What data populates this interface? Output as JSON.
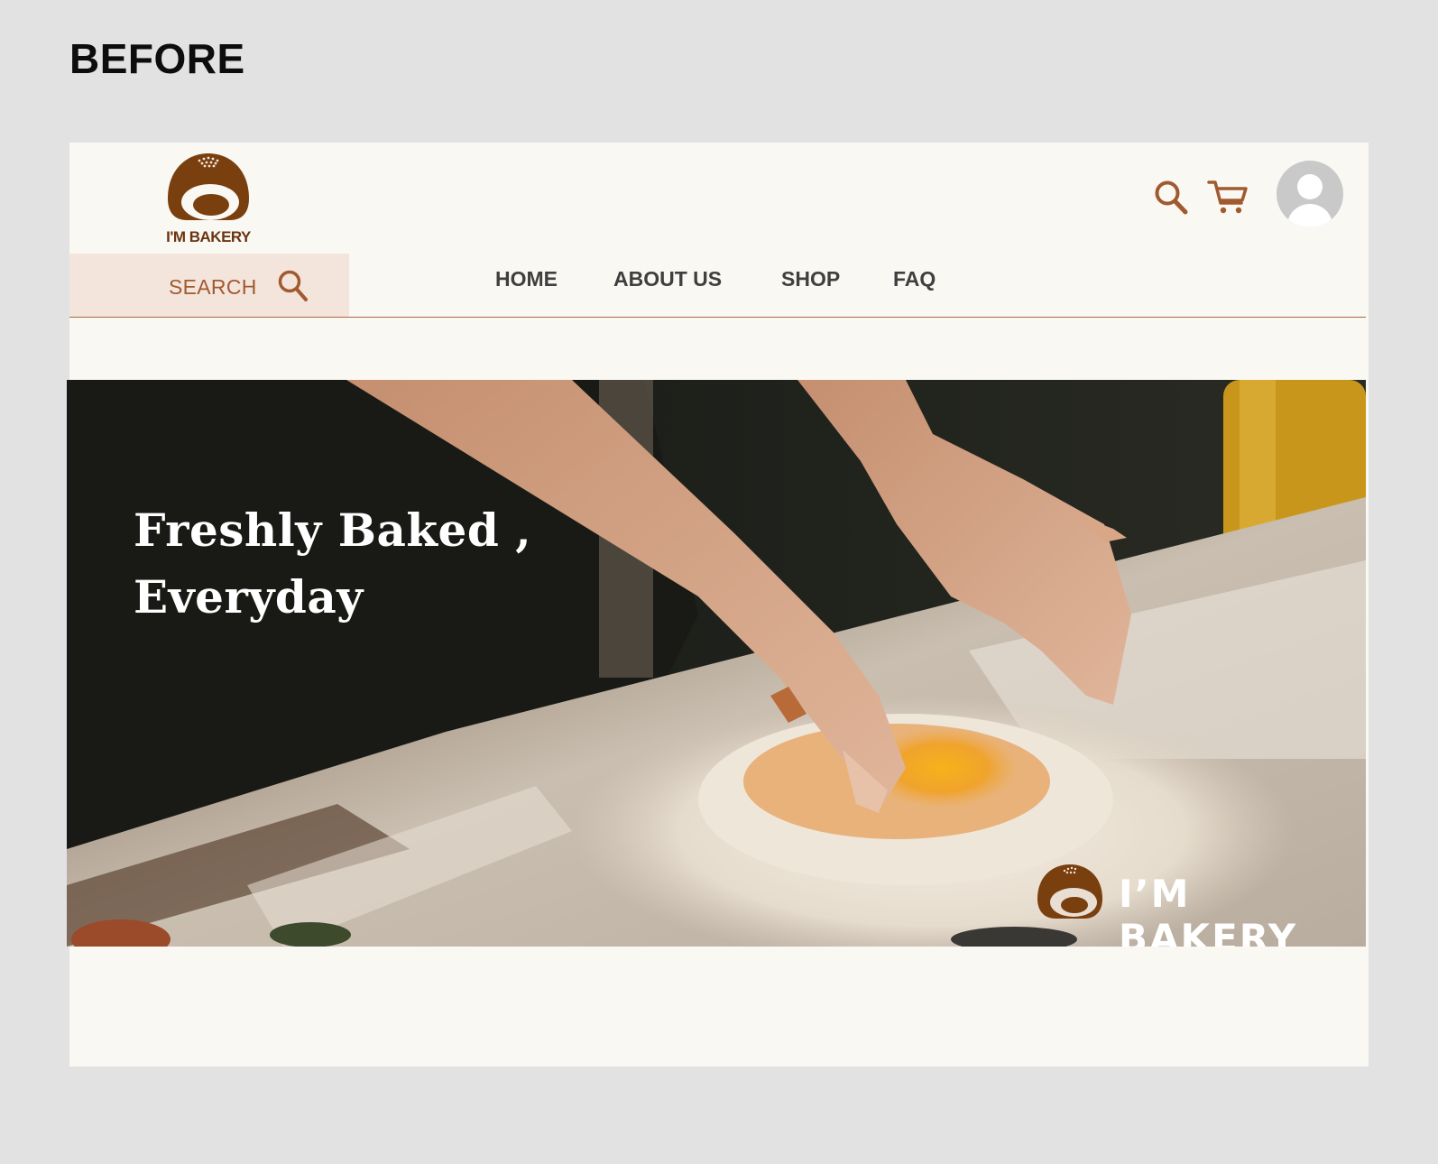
{
  "caption": "BEFORE",
  "brand": {
    "name": "I'M BAKERY",
    "color": "#7a3f0e"
  },
  "header": {
    "search_label": "SEARCH",
    "icons": [
      "search-icon",
      "cart-icon",
      "user-avatar-icon"
    ]
  },
  "nav": {
    "items": [
      {
        "label": "HOME"
      },
      {
        "label": "ABOUT US"
      },
      {
        "label": "SHOP"
      },
      {
        "label": "FAQ"
      }
    ]
  },
  "hero": {
    "title_line1": "Freshly Baked ,",
    "title_line2": "Everyday",
    "watermark": "I’M BAKERY"
  },
  "colors": {
    "accent": "#a15a30",
    "search_bg": "#f4e5dc",
    "page_bg": "#faf8f3",
    "outer_bg": "#e2e2e2"
  }
}
